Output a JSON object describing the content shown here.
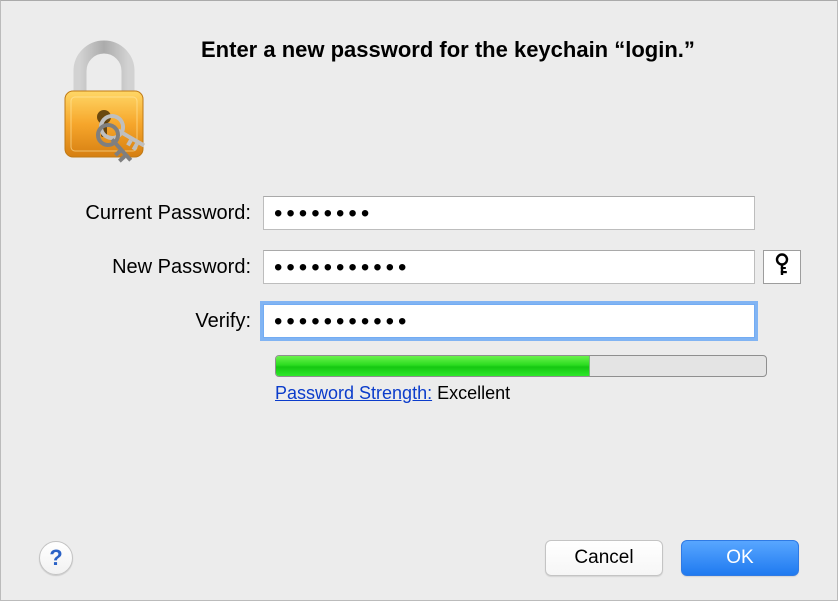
{
  "dialog": {
    "title": "Enter a new password for the keychain “login.”"
  },
  "fields": {
    "current": {
      "label": "Current Password:",
      "value": "••••••••"
    },
    "new": {
      "label": "New Password:",
      "value": "•••••••••••"
    },
    "verify": {
      "label": "Verify:",
      "value": "•••••••••••"
    }
  },
  "strength": {
    "link_label": "Password Strength:",
    "value_label": "Excellent",
    "percent": 64
  },
  "buttons": {
    "help": "?",
    "cancel": "Cancel",
    "ok": "OK"
  },
  "icons": {
    "lock": "lock-icon",
    "key_assist": "key-icon"
  }
}
